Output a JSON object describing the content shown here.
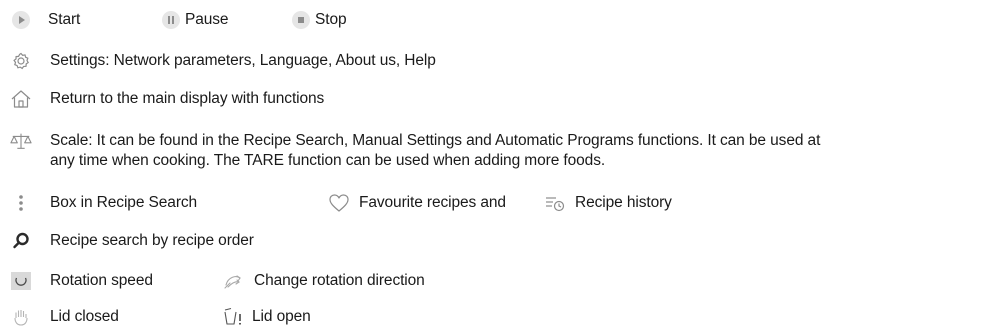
{
  "legend": {
    "start": {
      "icon": "play-icon",
      "label": "Start"
    },
    "pause": {
      "icon": "pause-icon",
      "label": "Pause"
    },
    "stop": {
      "icon": "stop-icon",
      "label": "Stop"
    },
    "settings": {
      "icon": "gear-icon",
      "label": "Settings: Network parameters, Language, About us, Help"
    },
    "home": {
      "icon": "home-icon",
      "label": "Return to the main display with functions"
    },
    "scale": {
      "icon": "scale-icon",
      "line1": "Scale: It can be found in the Recipe Search, Manual Settings and Automatic Programs functions. It can be used at",
      "line2": "any time when cooking. The TARE function can be used when adding more foods."
    },
    "box": {
      "icon": "vertical-dots-icon",
      "label": "Box in Recipe Search"
    },
    "favourites": {
      "icon": "heart-icon",
      "label": "Favourite recipes and"
    },
    "history": {
      "icon": "history-icon",
      "label": "Recipe history"
    },
    "search": {
      "icon": "search-icon",
      "label": "Recipe search by recipe order"
    },
    "rotation_speed": {
      "icon": "rotation-speed-icon",
      "label": "Rotation speed"
    },
    "rotation_direction": {
      "icon": "rotation-direction-icon",
      "label": "Change rotation direction"
    },
    "lid_closed": {
      "icon": "lid-closed-icon",
      "label": "Lid closed"
    },
    "lid_open": {
      "icon": "lid-open-icon",
      "label": "Lid open"
    }
  },
  "colors": {
    "icon_gray": "#9b9b9b",
    "icon_light": "#d9d9d9",
    "icon_dark": "#2b2b2b",
    "text": "#1a1a1a"
  }
}
